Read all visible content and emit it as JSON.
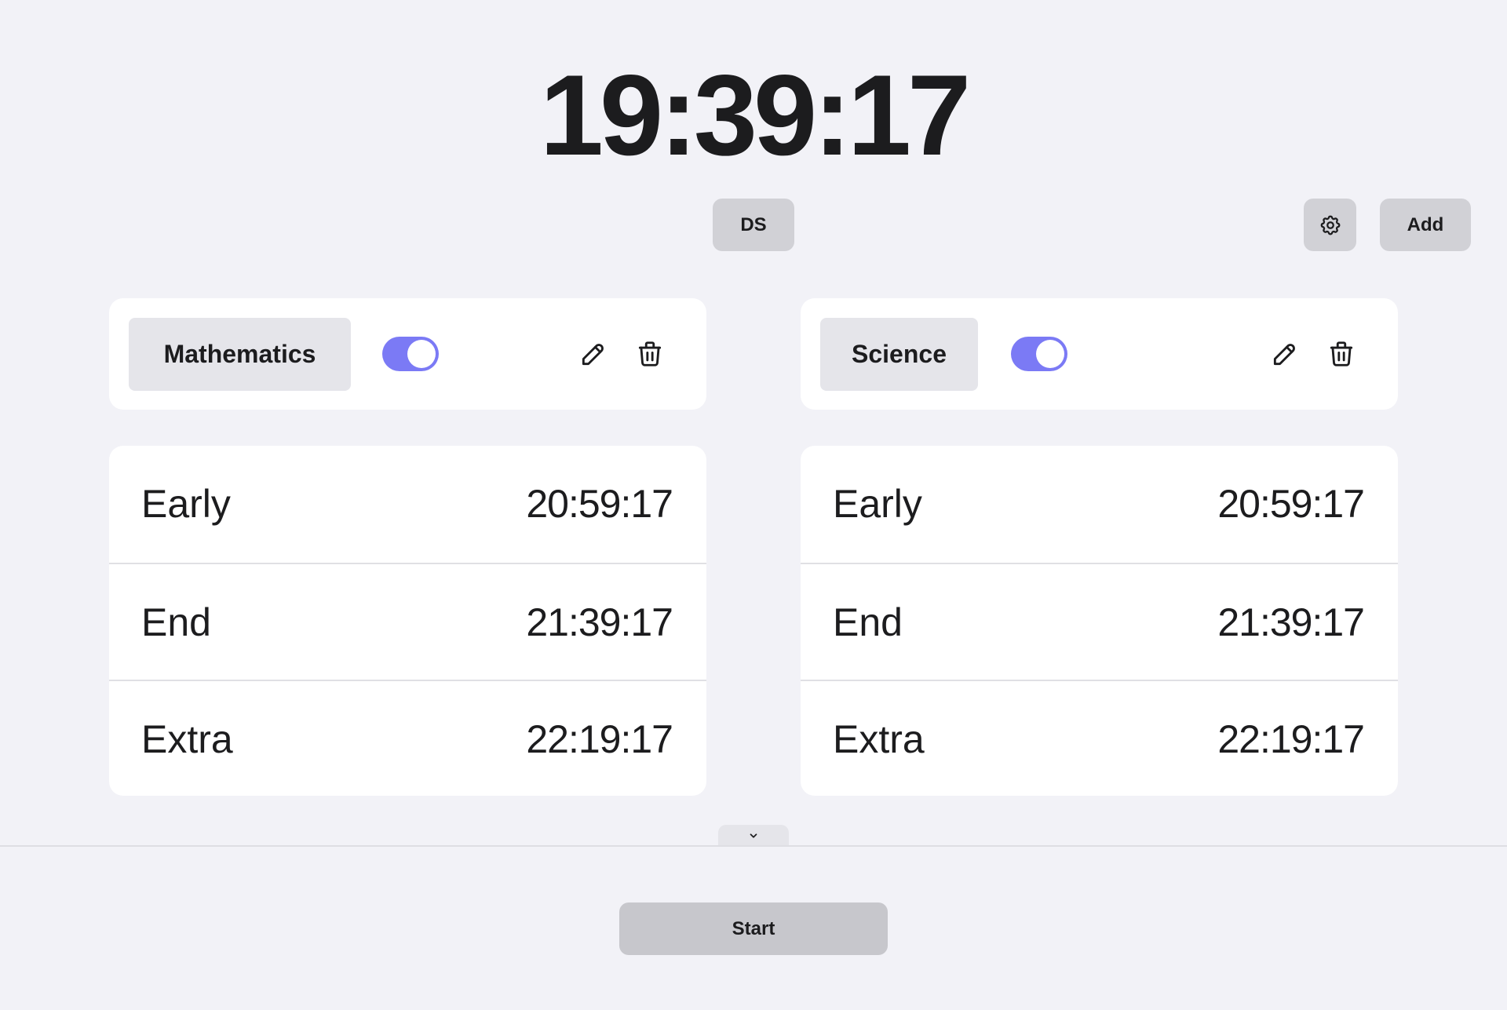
{
  "clock": {
    "time": "19:39:17"
  },
  "toolbar": {
    "ds_label": "DS",
    "settings_icon": "gear-icon",
    "add_label": "Add"
  },
  "colors": {
    "background": "#f2f2f7",
    "toggle_on": "#7b7af5",
    "button": "#d1d1d6"
  },
  "subjects": [
    {
      "name": "Mathematics",
      "enabled": true,
      "times": [
        {
          "label": "Early",
          "value": "20:59:17"
        },
        {
          "label": "End",
          "value": "21:39:17"
        },
        {
          "label": "Extra",
          "value": "22:19:17"
        }
      ]
    },
    {
      "name": "Science",
      "enabled": true,
      "times": [
        {
          "label": "Early",
          "value": "20:59:17"
        },
        {
          "label": "End",
          "value": "21:39:17"
        },
        {
          "label": "Extra",
          "value": "22:19:17"
        }
      ]
    }
  ],
  "footer": {
    "collapse_icon": "chevron-down-icon",
    "start_label": "Start"
  }
}
